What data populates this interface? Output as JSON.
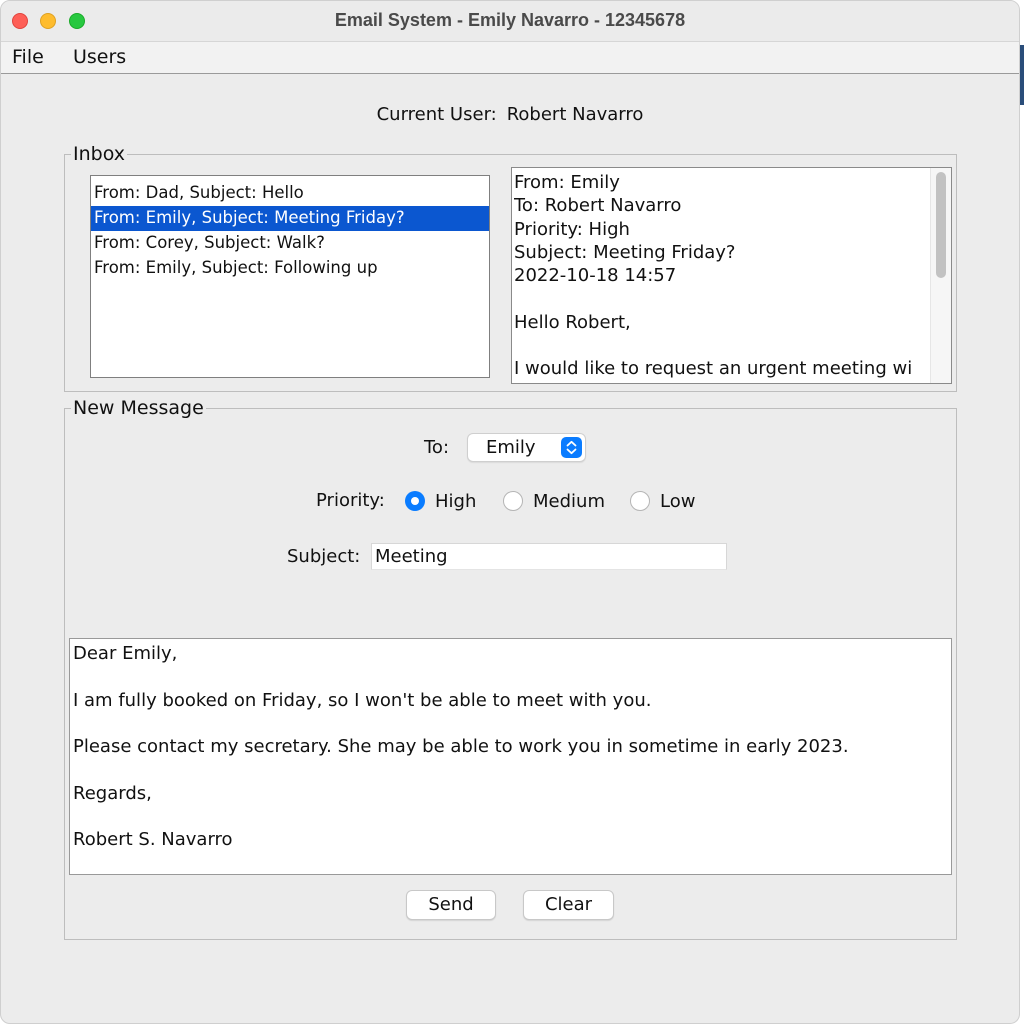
{
  "window": {
    "title": "Email System - Emily Navarro - 12345678"
  },
  "menubar": {
    "items": [
      "File",
      "Users"
    ]
  },
  "current_user": {
    "label": "Current User:",
    "name": "Robert Navarro"
  },
  "inbox": {
    "legend": "Inbox",
    "messages": [
      "From: Dad, Subject: Hello",
      "From: Emily, Subject: Meeting Friday?",
      "From: Corey, Subject: Walk?",
      "From: Emily, Subject: Following up"
    ],
    "selected_index": 1,
    "preview": "From: Emily\nTo: Robert Navarro\nPriority: High\nSubject: Meeting Friday?\n2022-10-18 14:57\n\nHello Robert,\n\nI would like to request an urgent meeting wi"
  },
  "new_message": {
    "legend": "New Message",
    "to_label": "To:",
    "to_value": "Emily",
    "priority_label": "Priority:",
    "priority_options": [
      "High",
      "Medium",
      "Low"
    ],
    "priority_selected": "High",
    "subject_label": "Subject:",
    "subject_value": "Meeting",
    "body": "Dear Emily,\n\nI am fully booked on Friday, so I won't be able to meet with you.\n\nPlease contact my secretary. She may be able to work you in sometime in early 2023.\n\nRegards,\n\nRobert S. Navarro",
    "send_label": "Send",
    "clear_label": "Clear"
  },
  "colors": {
    "selection": "#0b57d0",
    "accent": "#0a7cff"
  }
}
